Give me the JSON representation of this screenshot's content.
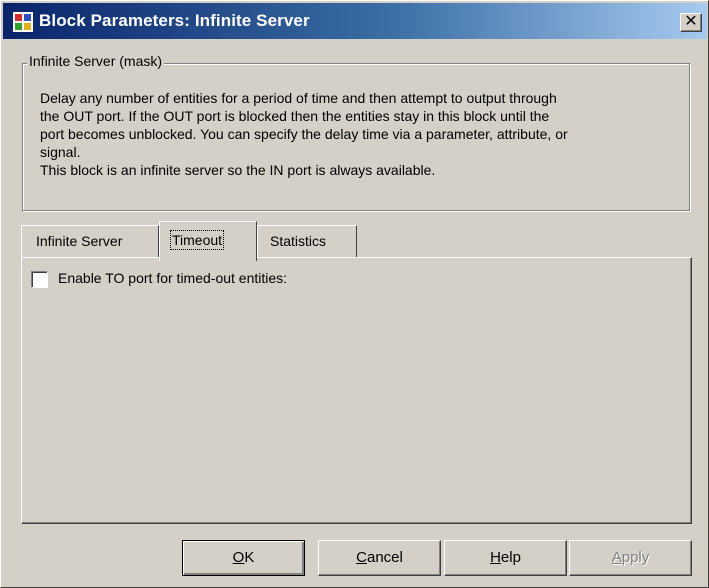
{
  "window": {
    "title": "Block Parameters: Infinite Server",
    "close_glyph": "✕",
    "icon": "simulink-block-icon"
  },
  "mask": {
    "group_title": "Infinite Server (mask)",
    "description_lines": [
      "Delay any number of entities for a period of time and then attempt to output through",
      "the OUT port. If the OUT port is blocked then the entities stay in this block until the",
      "port becomes unblocked. You can specify the delay time via a parameter, attribute, or",
      "signal."
    ],
    "description_last": "This block is an infinite server so the IN port is always available."
  },
  "tabs": [
    {
      "label": "Infinite Server",
      "active": false
    },
    {
      "label": "Timeout",
      "active": true
    },
    {
      "label": "Statistics",
      "active": false
    }
  ],
  "timeout_panel": {
    "enable_to_port_label": "Enable TO port for timed-out entities:",
    "enable_to_port_checked": false
  },
  "buttons": {
    "ok": {
      "mnemonic": "O",
      "rest": "K"
    },
    "cancel": {
      "mnemonic": "C",
      "rest": "ancel"
    },
    "help": {
      "mnemonic": "H",
      "rest": "elp"
    },
    "apply": {
      "mnemonic": "A",
      "rest": "pply"
    }
  },
  "colors": {
    "titlebar_start": "#0a246a",
    "titlebar_end": "#a6caf0",
    "face": "#d4d0c8"
  }
}
